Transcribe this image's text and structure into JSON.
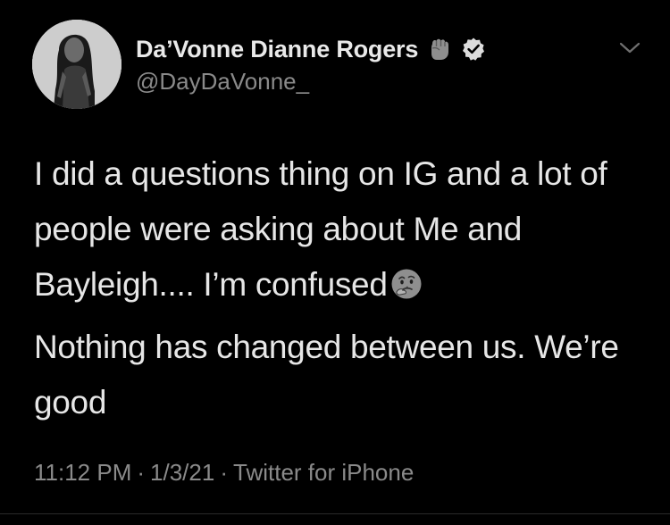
{
  "tweet": {
    "author": {
      "display_name": "Da’Vonne Dianne Rogers",
      "handle": "@DayDaVonne_",
      "name_emoji": "raised-fist",
      "verified": true,
      "avatar": "profile-photo"
    },
    "body": {
      "paragraph_1": "I did a questions thing on IG and a lot of people were asking about Me and Bayleigh.... I’m confused",
      "paragraph_1_emoji": "thinking-face",
      "paragraph_2": "Nothing has changed between us. We’re good"
    },
    "meta": {
      "time": "11:12 PM",
      "date": "1/3/21",
      "source": "Twitter for iPhone",
      "separator": "·"
    }
  },
  "icons": {
    "menu": "chevron-down-icon",
    "verified": "verified-badge-icon"
  },
  "colors": {
    "background": "#000000",
    "primary_text": "#e6e6e6",
    "secondary_text": "#8a8a8a"
  }
}
